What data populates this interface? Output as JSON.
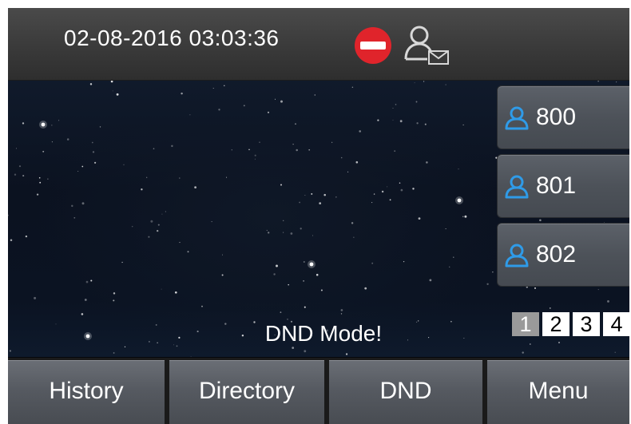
{
  "status_bar": {
    "datetime": "02-08-2016 03:03:36",
    "dnd_icon": "do-not-disturb-icon",
    "account_icon": "account-voicemail-icon",
    "dnd_color": "#e0242b"
  },
  "line_keys": [
    {
      "label": "800",
      "icon": "user-icon"
    },
    {
      "label": "801",
      "icon": "user-icon"
    },
    {
      "label": "802",
      "icon": "user-icon"
    }
  ],
  "line_key_icon_color": "#2f9be8",
  "pages": [
    {
      "label": "1",
      "active": true
    },
    {
      "label": "2",
      "active": false
    },
    {
      "label": "3",
      "active": false
    },
    {
      "label": "4",
      "active": false
    }
  ],
  "message": "DND Mode!",
  "softkeys": [
    {
      "label": "History"
    },
    {
      "label": "Directory"
    },
    {
      "label": "DND"
    },
    {
      "label": "Menu"
    }
  ]
}
